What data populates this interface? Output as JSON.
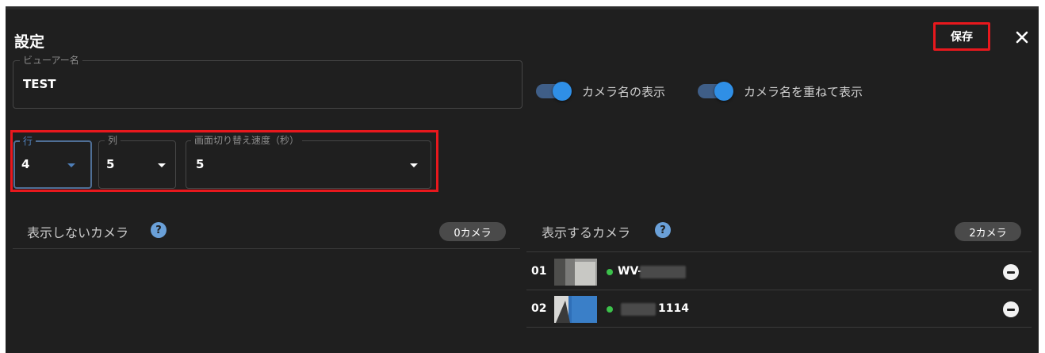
{
  "dialog": {
    "title": "設定",
    "save_label": "保存"
  },
  "viewer_name": {
    "legend": "ビューアー名",
    "value": "TEST"
  },
  "toggles": [
    {
      "label": "カメラ名の表示",
      "on": true
    },
    {
      "label": "カメラ名を重ねて表示",
      "on": true
    }
  ],
  "grid": {
    "rows": {
      "legend": "行",
      "value": "4"
    },
    "cols": {
      "legend": "列",
      "value": "5"
    },
    "speed": {
      "legend": "画面切り替え速度（秒）",
      "value": "5"
    }
  },
  "hidden_cameras": {
    "title": "表示しないカメラ",
    "count": "0カメラ"
  },
  "shown_cameras": {
    "title": "表示するカメラ",
    "count": "2カメラ",
    "items": [
      {
        "num": "01",
        "name": "WV-",
        "status": "online"
      },
      {
        "num": "02",
        "name": "1114",
        "status": "online"
      }
    ]
  },
  "colors": {
    "accent": "#2f8fe6",
    "highlight": "#e8181d",
    "status_online": "#3cc24b",
    "background": "#1f1f1f"
  }
}
